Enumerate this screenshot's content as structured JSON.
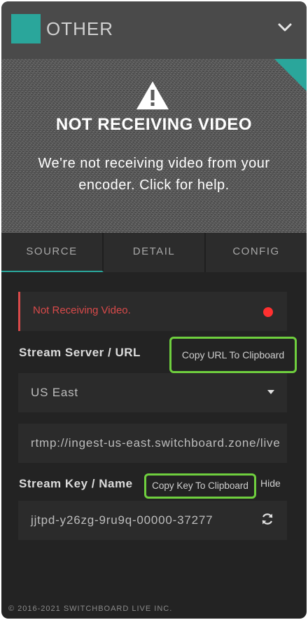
{
  "header": {
    "title": "OTHER",
    "swatch_color": "#2aa69b",
    "toggle_icon": "chevron-down-icon"
  },
  "video": {
    "icon": "warning-triangle-icon",
    "heading": "NOT RECEIVING VIDEO",
    "message": "We're not receiving video from your encoder. Click for help."
  },
  "tabs": [
    {
      "label": "SOURCE",
      "active": true
    },
    {
      "label": "DETAIL",
      "active": false
    },
    {
      "label": "CONFIG",
      "active": false
    }
  ],
  "status": {
    "text": "Not Receiving Video.",
    "color": "#d94a4a"
  },
  "stream_server": {
    "label": "Stream Server / URL",
    "copy_label": "Copy URL To Clipboard",
    "region": "US East",
    "url": "rtmp://ingest-us-east.switchboard.zone/live"
  },
  "stream_key": {
    "label": "Stream Key / Name",
    "copy_label": "Copy Key To Clipboard",
    "hide_label": "Hide",
    "key": "jjtpd-y26zg-9ru9q-00000-37277",
    "refresh_icon": "refresh-icon"
  },
  "footer": {
    "copyright": "© 2016-2021 SWITCHBOARD LIVE INC."
  },
  "colors": {
    "accent": "#2aa69b",
    "highlight": "#6fcf3e",
    "error": "#ff3030"
  }
}
